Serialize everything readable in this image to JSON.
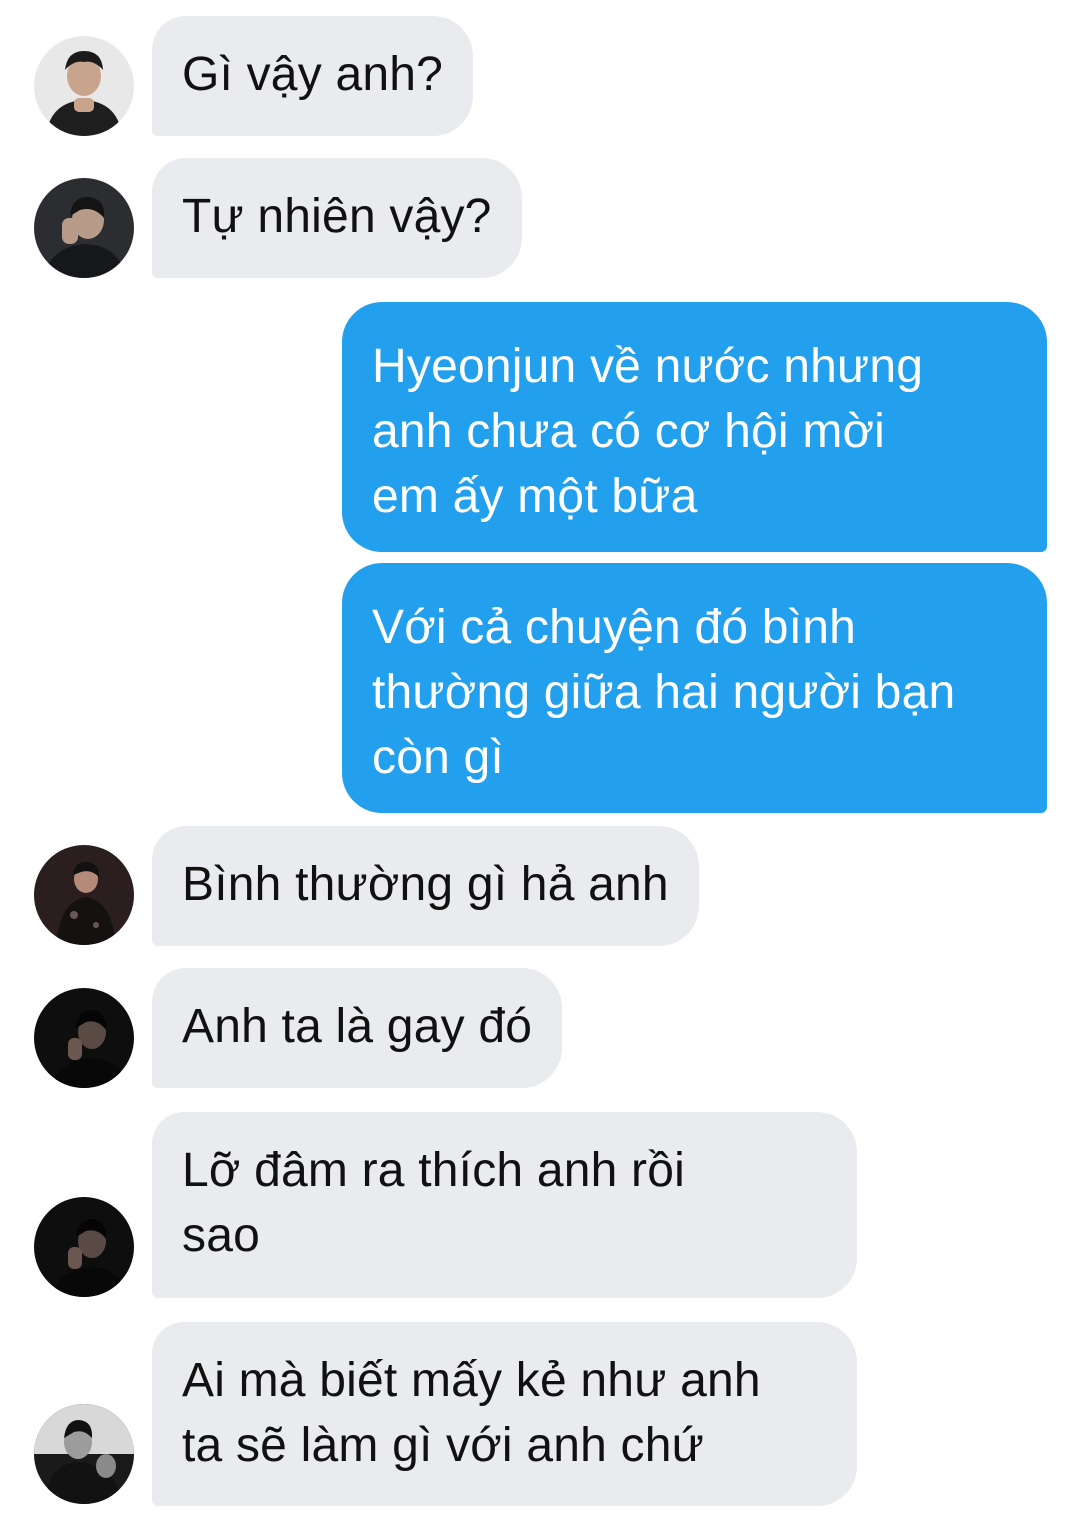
{
  "messages": [
    {
      "direction": "in",
      "avatar": "avatar-1",
      "lines": [
        "Gì vậy anh?"
      ]
    },
    {
      "direction": "in",
      "avatar": "avatar-2",
      "lines": [
        "Tự nhiên vậy?"
      ]
    },
    {
      "direction": "out",
      "lines": [
        "Hyeonjun về nước nhưng",
        "anh chưa có cơ hội mời",
        "em ấy một bữa"
      ]
    },
    {
      "direction": "out",
      "lines": [
        "Với cả chuyện đó bình",
        "thường giữa hai người bạn",
        "còn gì"
      ]
    },
    {
      "direction": "in",
      "avatar": "avatar-3",
      "lines": [
        "Bình thường gì hả anh"
      ]
    },
    {
      "direction": "in",
      "avatar": "avatar-4",
      "lines": [
        "Anh ta là gay đó"
      ]
    },
    {
      "direction": "in",
      "avatar": "avatar-4",
      "lines": [
        "Lỡ đâm ra thích anh rồi",
        "sao"
      ]
    },
    {
      "direction": "in",
      "avatar": "avatar-5",
      "lines": [
        "Ai mà biết mấy kẻ như anh",
        "ta sẽ làm gì với anh chứ"
      ]
    }
  ],
  "colors": {
    "incoming_bubble": "#e9ebef",
    "outgoing_bubble": "#22a0ee",
    "incoming_text": "#111111",
    "outgoing_text": "#ffffff",
    "background": "#ffffff"
  }
}
